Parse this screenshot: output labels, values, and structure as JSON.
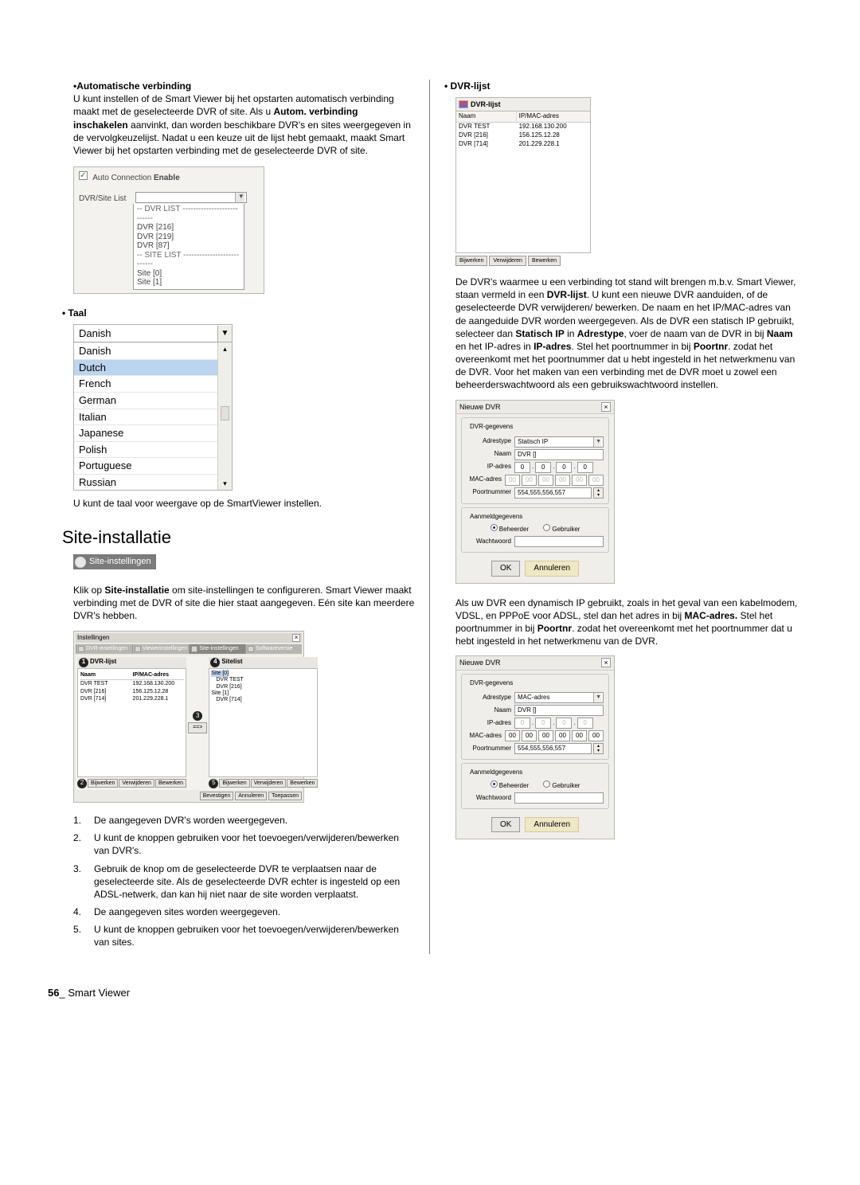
{
  "left": {
    "auto_conn": {
      "title": "Automatische verbinding",
      "para": "U kunt instellen of de Smart Viewer bij het opstarten automatisch verbinding maakt met de geselecteerde DVR of site. Als u ",
      "bold1": "Autom. verbinding inschakelen",
      "para2": " aanvinkt, dan worden beschikbare DVR's en sites weergegeven in de vervolgkeuzelijst. Nadat u een keuze uit de lijst hebt gemaakt, maakt Smart Viewer bij het opstarten verbinding met de geselecteerde DVR of site.",
      "chk_label": "Auto Connection",
      "chk_bold": "Enable",
      "list_label": "DVR/Site List",
      "items_hdr1": "-- DVR LIST ---------------------------",
      "items": [
        "DVR [216]",
        "DVR [219]",
        "DVR [87]"
      ],
      "items_hdr2": "-- SITE LIST ---------------------------",
      "items2": [
        "Site [0]",
        "Site [1]"
      ]
    },
    "taal": {
      "label": "Taal",
      "selected": "Danish",
      "options": [
        "Danish",
        "Dutch",
        "French",
        "German",
        "Italian",
        "Japanese",
        "Polish",
        "Portuguese",
        "Russian"
      ],
      "highlight": "Dutch",
      "note": "U kunt de taal voor weergave op de SmartViewer instellen."
    },
    "site_heading": "Site-installatie",
    "site_chip": "Site-instellingen",
    "site_para_a": "Klik op ",
    "site_para_bold": "Site-installatie",
    "site_para_b": " om site-instellingen te configureren. Smart Viewer maakt verbinding met de DVR of site die hier staat aangegeven. Eén site kan meerdere DVR's hebben.",
    "dlg": {
      "title": "Instellingen",
      "tabs": [
        "DVR-instellingen",
        "Viewerinstellingen",
        "Site-instellingen",
        "Softwareversie"
      ],
      "list_title": "DVR-lijst",
      "list_head": [
        "Naam",
        "IP/MAC-adres"
      ],
      "list_rows": [
        {
          "n": "DVR TEST",
          "a": "192.168.130.200"
        },
        {
          "n": "DVR [216]",
          "a": "156.125.12.28"
        },
        {
          "n": "DVR [714]",
          "a": "201.229.228.1"
        }
      ],
      "btns_left": [
        "Bijwerken",
        "Verwijderen",
        "Bewerken"
      ],
      "arrow": "==>",
      "sitelist_title": "Sitelist",
      "tree_root": "Site [0]",
      "tree_items": [
        "DVR TEST",
        "DVR [216]"
      ],
      "tree_root2": "Site [1]",
      "tree_items2": [
        "DVR [714]"
      ],
      "btns_right": [
        "Bijwerken",
        "Verwijderen",
        "Bewerken"
      ],
      "foot": [
        "Bevestigen",
        "Annuleren",
        "Toepassen"
      ]
    },
    "ol": [
      "De aangegeven DVR's worden weergegeven.",
      "U kunt de knoppen gebruiken voor het toevoegen/verwijderen/bewerken van DVR's.",
      "Gebruik de knop om de geselecteerde DVR te verplaatsen naar de geselecteerde site. Als de geselecteerde DVR echter is ingesteld op een ADSL-netwerk, dan kan hij niet naar de site worden verplaatst.",
      "De aangegeven sites worden weergegeven.",
      "U kunt de knoppen gebruiken voor het toevoegen/verwijderen/bewerken van sites."
    ]
  },
  "right": {
    "dvrlijst_label": "DVR-lijst",
    "dl": {
      "title": "DVR-lijst",
      "head": [
        "Naam",
        "IP/MAC-adres"
      ],
      "rows": [
        {
          "n": "DVR TEST",
          "a": "192.168.130.200"
        },
        {
          "n": "DVR [216]",
          "a": "156.125.12.28"
        },
        {
          "n": "DVR [714]",
          "a": "201.229.228.1"
        }
      ],
      "btns": [
        "Bijwerken",
        "Verwijderen",
        "Bewerken"
      ]
    },
    "para1_a": "De DVR's waarmee u een verbinding tot stand wilt brengen m.b.v. Smart Viewer, staan vermeld in een ",
    "para1_b1": "DVR-lijst",
    "para1_b": ". U kunt een nieuwe DVR aanduiden, of de geselecteerde DVR verwijderen/ bewerken. De naam en het IP/MAC-adres van de aangeduide DVR worden weergegeven. Als de DVR een statisch IP gebruikt, selecteer dan ",
    "para1_b2": "Statisch IP",
    "para1_c": " in ",
    "para1_b3": "Adrestype",
    "para1_d": ", voer de naam van de DVR in bij ",
    "para1_b4": "Naam",
    "para1_e": " en het IP-adres in ",
    "para1_b5": "IP-adres",
    "para1_f": ". Stel het poortnummer in bij ",
    "para1_b6": "Poortnr",
    "para1_g": ". zodat het overeenkomt met het poortnummer dat u hebt ingesteld in het netwerkmenu van de DVR. Voor het maken van een verbinding met de DVR moet u zowel een beheerderswachtwoord als een gebruikswachtwoord instellen.",
    "nd1": {
      "title": "Nieuwe DVR",
      "g1": "DVR-gegevens",
      "adrestype_l": "Adrestype",
      "adrestype_v": "Statisch IP",
      "naam_l": "Naam",
      "naam_v": "DVR []",
      "ip_l": "IP-adres",
      "ip": [
        "0",
        "0",
        "0",
        "0"
      ],
      "mac_l": "MAC-adres",
      "mac": [
        "00",
        "00",
        "00",
        "00",
        "00",
        "00"
      ],
      "port_l": "Poortnummer",
      "port_v": "554,555,556,557",
      "g2": "Aanmeldgegevens",
      "r1": "Beheerder",
      "r2": "Gebruiker",
      "pw_l": "Wachtwoord",
      "ok": "OK",
      "cancel": "Annuleren"
    },
    "para2_a": "Als uw DVR een dynamisch IP gebruikt, zoals in het geval van een kabelmodem, VDSL, en PPPoE voor ADSL, stel dan het adres in bij ",
    "para2_b1": "MAC-adres.",
    "para2_b": " Stel het poortnummer in bij ",
    "para2_b2": "Poortnr",
    "para2_c": ". zodat het overeenkomt met het poortnummer dat u hebt ingesteld in het netwerkmenu van de DVR.",
    "nd2": {
      "adrestype_v": "MAC-adres"
    }
  },
  "footer": {
    "page": "56",
    "sep": "_ ",
    "label": "Smart Viewer"
  }
}
